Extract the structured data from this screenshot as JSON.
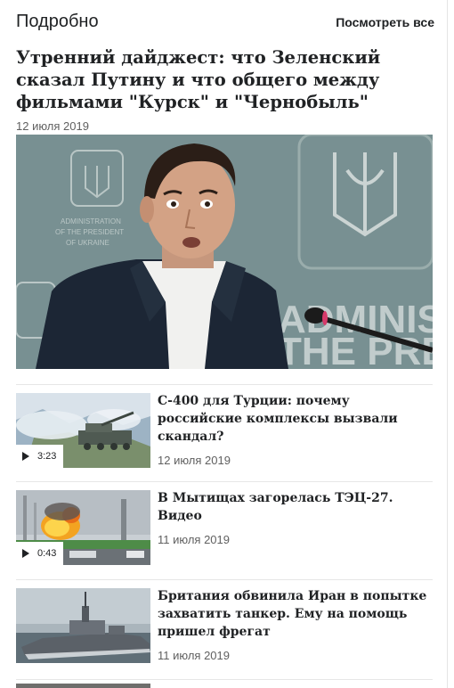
{
  "header": {
    "section_title": "Подробно",
    "see_all": "Посмотреть все"
  },
  "lead": {
    "title": "Утренний дайджест: что Зеленский сказал Путину и что общего между фильмами \"Курск\" и \"Чернобыль\"",
    "date": "12 июля 2019",
    "image_text": [
      "ADMINISTRATION",
      "OF THE PRESIDENT",
      "OF UKRAINE",
      "ADMINISTRATI",
      "THE PRESID"
    ]
  },
  "items": [
    {
      "title": "С-400 для Турции: почему российские комплексы вызвали скандал?",
      "date": "12 июля 2019",
      "duration": "3:23",
      "icon": "play-icon"
    },
    {
      "title": "В Мытищах загорелась ТЭЦ-27. Видео",
      "date": "11 июля 2019",
      "duration": "0:43",
      "icon": "play-icon"
    },
    {
      "title": "Британия обвинила Иран в попытке захватить танкер. Ему на помощь пришел фрегат",
      "date": "11 июля 2019"
    }
  ],
  "colors": {
    "text": "#202224",
    "date": "#606060",
    "divider": "#e6e6e6",
    "background": "#ffffff"
  }
}
